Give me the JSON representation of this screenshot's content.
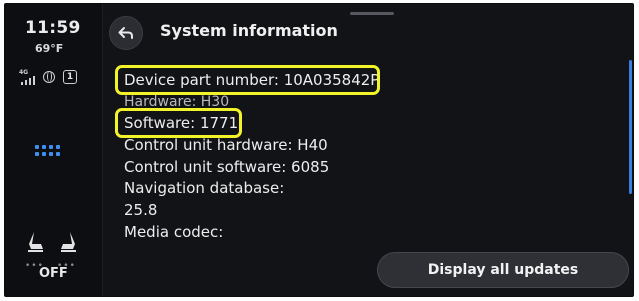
{
  "status": {
    "time": "11:59",
    "temperature": "69°F",
    "network": "4G",
    "notification_count": "1"
  },
  "sidebar": {
    "seat_off_label": "OFF"
  },
  "header": {
    "title": "System information"
  },
  "info": {
    "device_part_number": "Device part number: 10A035842P",
    "hardware": "Hardware: H30",
    "software": "Software: 1771",
    "control_unit_hardware": "Control unit hardware: H40",
    "control_unit_software": "Control unit software: 6085",
    "navigation_database_label": "Navigation database:",
    "navigation_database_value": "25.8",
    "media_codec": "Media codec:"
  },
  "actions": {
    "display_updates": "Display all updates"
  },
  "colors": {
    "highlight": "#f3f32a",
    "accent": "#3f8ef2",
    "background": "#121317"
  },
  "icons": {
    "back": "back-arrow-icon",
    "signal": "signal-icon",
    "globe": "globe-icon",
    "apps": "apps-grid-icon",
    "seat_heat_left": "seat-heat-icon",
    "seat_heat_right": "seat-heat-icon"
  }
}
